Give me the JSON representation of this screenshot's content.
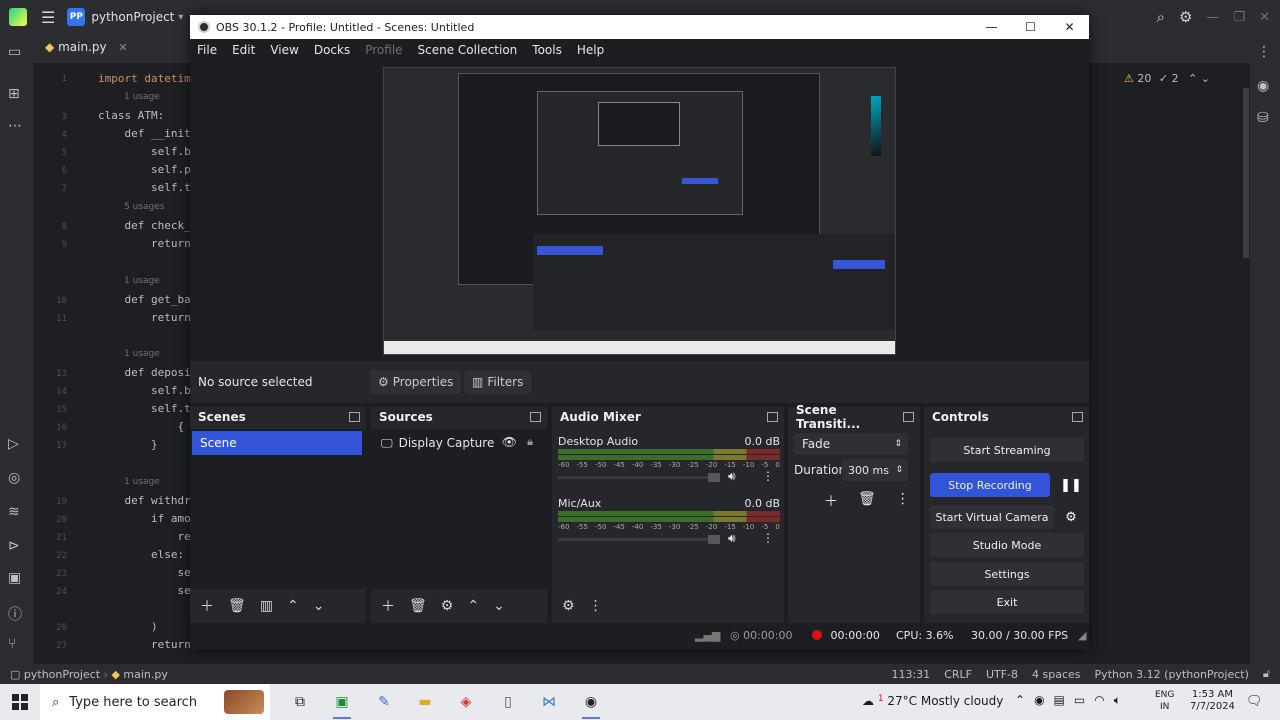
{
  "ide": {
    "project_badge": "PP",
    "project_name": "pythonProject",
    "file_tab": "main.py",
    "warnings_count": "20",
    "checks_count": "2",
    "code_lines": [
      {
        "n": "1",
        "text": "import datetim"
      },
      {
        "n": "2",
        "text": ""
      },
      {
        "n": "3",
        "text": "class ATM:"
      },
      {
        "n": "4",
        "text": "    def __init_"
      },
      {
        "n": "5",
        "text": "        self.b"
      },
      {
        "n": "6",
        "text": "        self.p"
      },
      {
        "n": "7",
        "text": "        self.t"
      },
      {
        "n": "8",
        "text": "    def check_"
      },
      {
        "n": "9",
        "text": "        return"
      },
      {
        "n": "10",
        "text": "    def get_ba"
      },
      {
        "n": "11",
        "text": "        return"
      },
      {
        "n": "13",
        "text": "    def deposi"
      },
      {
        "n": "14",
        "text": "        self.b"
      },
      {
        "n": "15",
        "text": "        self.t"
      },
      {
        "n": "16",
        "text": "            {"
      },
      {
        "n": "17",
        "text": "        }"
      },
      {
        "n": "19",
        "text": "    def withdr"
      },
      {
        "n": "20",
        "text": "        if amo"
      },
      {
        "n": "21",
        "text": "            re"
      },
      {
        "n": "22",
        "text": "        else:"
      },
      {
        "n": "23",
        "text": "            se"
      },
      {
        "n": "24",
        "text": "            se"
      },
      {
        "n": "26",
        "text": "        )"
      },
      {
        "n": "27",
        "text": "        return True"
      }
    ],
    "usages": [
      "1 usage",
      "5 usages",
      "1 usage",
      "1 usage",
      "1 usage"
    ],
    "status": {
      "crumb_project": "pythonProject",
      "crumb_file": "main.py",
      "position": "113:31",
      "line_sep": "CRLF",
      "encoding": "UTF-8",
      "indent": "4 spaces",
      "interpreter": "Python 3.12 (pythonProject)"
    }
  },
  "obs": {
    "title": "OBS 30.1.2 - Profile: Untitled - Scenes: Untitled",
    "menu": [
      "File",
      "Edit",
      "View",
      "Docks",
      "Profile",
      "Scene Collection",
      "Tools",
      "Help"
    ],
    "toolbar": {
      "no_source": "No source selected",
      "properties": "Properties",
      "filters": "Filters"
    },
    "scenes": {
      "title": "Scenes",
      "items": [
        "Scene"
      ]
    },
    "sources": {
      "title": "Sources",
      "items": [
        "Display Capture"
      ]
    },
    "mixer": {
      "title": "Audio Mixer",
      "channels": [
        {
          "name": "Desktop Audio",
          "db": "0.0 dB"
        },
        {
          "name": "Mic/Aux",
          "db": "0.0 dB"
        }
      ],
      "ticks": [
        "-60",
        "-55",
        "-50",
        "-45",
        "-40",
        "-35",
        "-30",
        "-25",
        "-20",
        "-15",
        "-10",
        "-5",
        "0"
      ]
    },
    "transitions": {
      "title": "Scene Transiti...",
      "type": "Fade",
      "duration_label": "Duration",
      "duration_value": "300 ms"
    },
    "controls": {
      "title": "Controls",
      "start_streaming": "Start Streaming",
      "stop_recording": "Stop Recording",
      "start_virtual_camera": "Start Virtual Camera",
      "studio_mode": "Studio Mode",
      "settings": "Settings",
      "exit": "Exit"
    },
    "status": {
      "stream_time": "00:00:00",
      "rec_time": "00:00:00",
      "cpu": "CPU: 3.6%",
      "fps": "30.00 / 30.00 FPS"
    }
  },
  "taskbar": {
    "search_placeholder": "Type here to search",
    "weather": "27°C  Mostly cloudy",
    "lang_top": "ENG",
    "lang_bottom": "IN",
    "time": "1:53 AM",
    "date": "7/7/2024",
    "notification_count": "1"
  }
}
